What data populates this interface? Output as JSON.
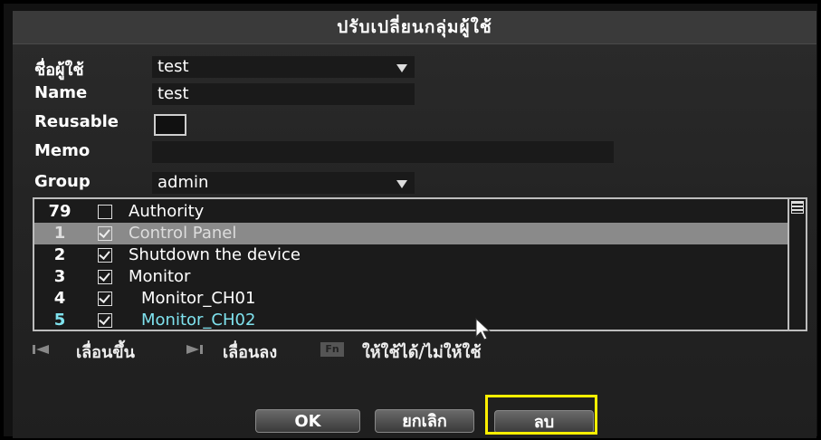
{
  "dialog": {
    "title": "ปรับเปลี่ยนกลุ่มผู้ใช้"
  },
  "form": {
    "user_label": "ชื่อผู้ใช้",
    "user_value": "test",
    "name_label": "Name",
    "name_value": "test",
    "reusable_label": "Reusable",
    "memo_label": "Memo",
    "memo_value": "",
    "group_label": "Group",
    "group_value": "admin"
  },
  "list": {
    "rows": [
      {
        "num": "79",
        "label": "Authority",
        "checked": false
      },
      {
        "num": "1",
        "label": "Control Panel",
        "checked": true
      },
      {
        "num": "2",
        "label": "Shutdown the device",
        "checked": true
      },
      {
        "num": "3",
        "label": "Monitor",
        "checked": true
      },
      {
        "num": "4",
        "label": "Monitor_CH01",
        "checked": true
      },
      {
        "num": "5",
        "label": "Monitor_CH02",
        "checked": true
      }
    ],
    "selected_row": 1
  },
  "hints": {
    "scroll_up": "เลื่อนขึ้น",
    "scroll_down": "เลื่อนลง",
    "toggle": "ให้ใช้ได้/ไม่ให้ใช้",
    "fn_key": "Fn"
  },
  "buttons": {
    "ok": "OK",
    "cancel": "ยกเลิก",
    "delete": "ลบ"
  },
  "colors": {
    "highlight": "#ffef00",
    "cyan_text": "#7fe2ee",
    "selected_row": "#8a8a8a"
  }
}
